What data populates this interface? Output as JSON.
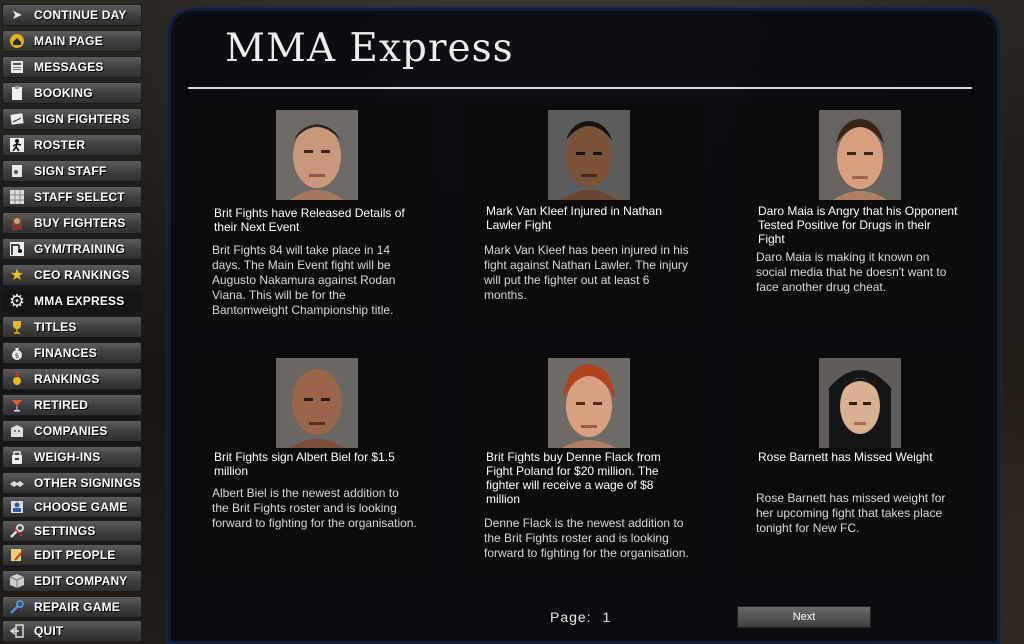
{
  "sidebar": {
    "items": [
      {
        "label": "CONTINUE DAY",
        "icon": "play-icon"
      },
      {
        "label": "MAIN PAGE",
        "icon": "home-icon"
      },
      {
        "label": "MESSAGES",
        "icon": "newspaper-icon"
      },
      {
        "label": "BOOKING",
        "icon": "clipboard-icon"
      },
      {
        "label": "SIGN FIGHTERS",
        "icon": "contract-icon"
      },
      {
        "label": "ROSTER",
        "icon": "fighter-icon"
      },
      {
        "label": "SIGN STAFF",
        "icon": "document-icon"
      },
      {
        "label": "STAFF SELECT",
        "icon": "grid-icon"
      },
      {
        "label": "BUY FIGHTERS",
        "icon": "person-icon"
      },
      {
        "label": "GYM/TRAINING",
        "icon": "gym-icon"
      },
      {
        "label": "CEO RANKINGS",
        "icon": "star-icon"
      },
      {
        "label": "MMA EXPRESS",
        "icon": "gear-icon"
      },
      {
        "label": "TITLES",
        "icon": "trophy-icon"
      },
      {
        "label": "FINANCES",
        "icon": "money-bag-icon"
      },
      {
        "label": "RANKINGS",
        "icon": "medal-icon"
      },
      {
        "label": "RETIRED",
        "icon": "cocktail-icon"
      },
      {
        "label": "COMPANIES",
        "icon": "building-icon"
      },
      {
        "label": "WEIGH-INS",
        "icon": "scale-icon"
      },
      {
        "label": "OTHER SIGNINGS",
        "icon": "handshake-icon"
      },
      {
        "label": "CHOOSE GAME",
        "icon": "person-badge-icon"
      },
      {
        "label": "SETTINGS",
        "icon": "wrench-icon"
      },
      {
        "label": "EDIT PEOPLE",
        "icon": "pencil-icon"
      },
      {
        "label": "EDIT COMPANY",
        "icon": "cube-icon"
      },
      {
        "label": "REPAIR GAME",
        "icon": "repair-icon"
      },
      {
        "label": "QUIT",
        "icon": "exit-icon"
      }
    ],
    "active": "MMA EXPRESS"
  },
  "page": {
    "title": "MMA Express"
  },
  "news": [
    {
      "headline": "Brit Fights have Released Details of their Next Event",
      "body": "Brit Fights 84 will take place in 14 days. The Main Event fight will be Augusto Nakamura against Rodan Viana. This will be for the Bantomweight Championship title.",
      "portrait": "male-fighter-portrait"
    },
    {
      "headline": "Mark Van Kleef Injured in Nathan Lawler Fight",
      "body": "Mark Van Kleef has been injured in his fight against Nathan Lawler. The injury will put the fighter out at least 6 months.",
      "portrait": "male-fighter-portrait"
    },
    {
      "headline": "Daro Maia is Angry that his Opponent Tested Positive for Drugs in their Fight",
      "body": "Daro Maia is making it known on social media that he doesn't want to face another drug cheat.",
      "portrait": "male-fighter-portrait"
    },
    {
      "headline": "Brit Fights sign Albert Biel for $1.5 million",
      "body": "Albert Biel is the newest addition to the Brit Fights roster and is looking forward to fighting for the organisation.",
      "portrait": "male-fighter-portrait"
    },
    {
      "headline": "Brit Fights buy Denne Flack from Fight Poland for $20 million. The fighter will receive a wage of $8 million",
      "body": "Denne Flack is the newest addition to the Brit Fights roster and is looking forward to fighting for the organisation.",
      "portrait": "male-fighter-portrait"
    },
    {
      "headline": "Rose Barnett has Missed Weight",
      "body": "Rose Barnett has missed weight for her upcoming fight that takes place tonight for New FC.",
      "portrait": "female-fighter-portrait"
    }
  ],
  "pagination": {
    "label": "Page:",
    "page": "1",
    "next_label": "Next"
  }
}
